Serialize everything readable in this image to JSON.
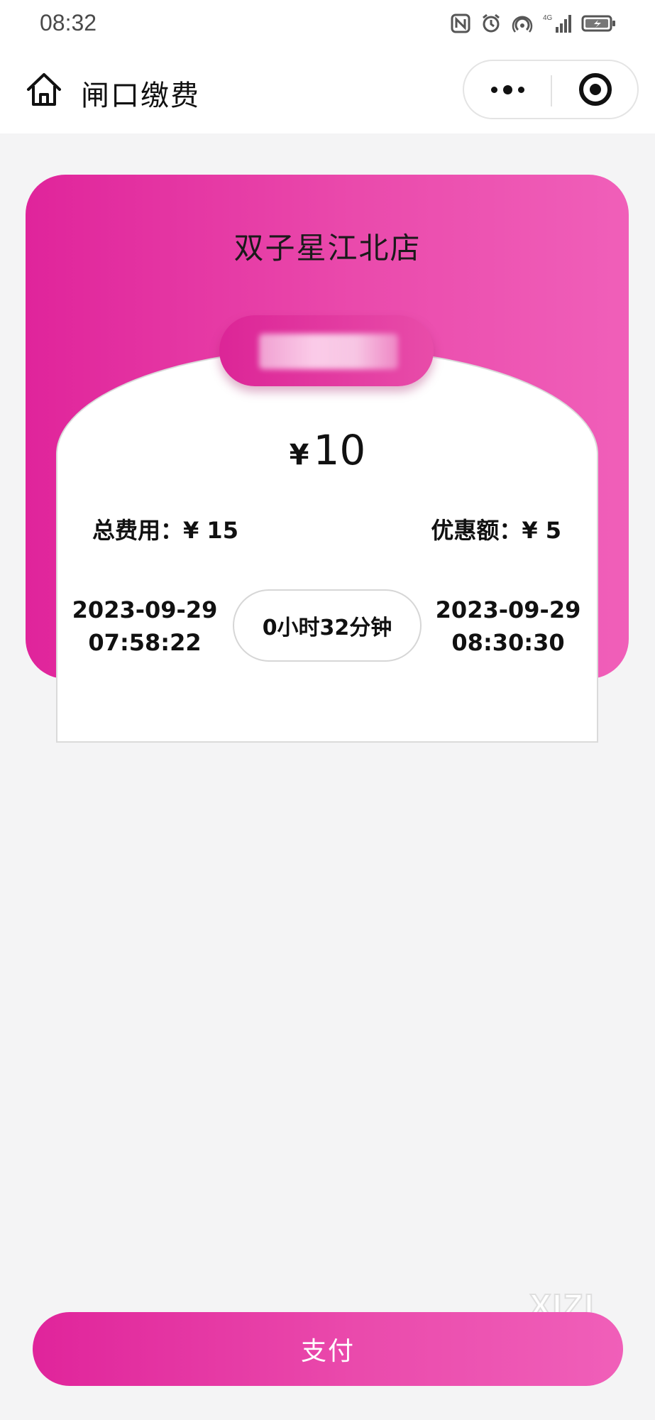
{
  "status_bar": {
    "time": "08:32",
    "icons": [
      "nfc-icon",
      "alarm-icon",
      "hotspot-icon",
      "signal-icon",
      "battery-icon"
    ],
    "network_label": "4G"
  },
  "nav": {
    "title": "闸口缴费",
    "home_icon": "home-icon",
    "more_icon": "more-dots-icon",
    "close_icon": "target-circle-icon"
  },
  "parking": {
    "store_name": "双子星江北店",
    "plate_number": "",
    "currency_symbol": "¥",
    "amount_due": "10",
    "total_fee_label": "总费用：",
    "total_fee_value": "¥ 15",
    "discount_label": "优惠额：",
    "discount_value": "¥ 5",
    "entry_date": "2023-09-29",
    "entry_time": "07:58:22",
    "duration": "0小时32分钟",
    "exit_date": "2023-09-29",
    "exit_time": "08:30:30"
  },
  "pay_button": {
    "label": "支付"
  },
  "watermark": {
    "text": "XIZI"
  },
  "colors": {
    "accent_start": "#e0249b",
    "accent_end": "#f05fb9",
    "page_background": "#f4f4f5"
  }
}
